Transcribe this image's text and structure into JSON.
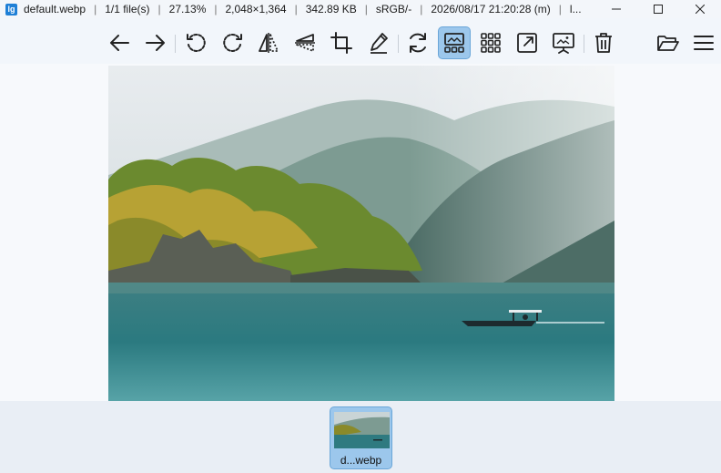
{
  "titlebar": {
    "app_icon_text": "lg",
    "filename": "default.webp",
    "file_count": "1/1 file(s)",
    "zoom": "27.13%",
    "dimensions": "2,048×1,364",
    "file_size": "342.89 KB",
    "color_profile": "sRGB/-",
    "datetime": "2026/08/17 21:20:28 (m)",
    "truncated": "l...",
    "separator": "|"
  },
  "window_controls": [
    "minimize-icon",
    "maximize-icon",
    "close-icon"
  ],
  "toolbar": {
    "tools": [
      "arrow-left-icon",
      "arrow-right-icon",
      "rotate-left-icon",
      "rotate-right-icon",
      "flip-horizontal-icon",
      "flip-vertical-icon",
      "crop-icon",
      "edit-pen-icon",
      "refresh-icon",
      "filmstrip-view-icon",
      "grid-view-icon",
      "fullscreen-icon",
      "slideshow-icon",
      "trash-icon",
      "open-folder-icon",
      "menu-icon"
    ],
    "active_tool": "filmstrip-view-icon"
  },
  "thumbnail": {
    "label": "d...webp"
  },
  "colors": {
    "active_bg": "#9cc7ec",
    "app_icon": "#1e7fd6",
    "strip_bg": "#e9eef5"
  }
}
